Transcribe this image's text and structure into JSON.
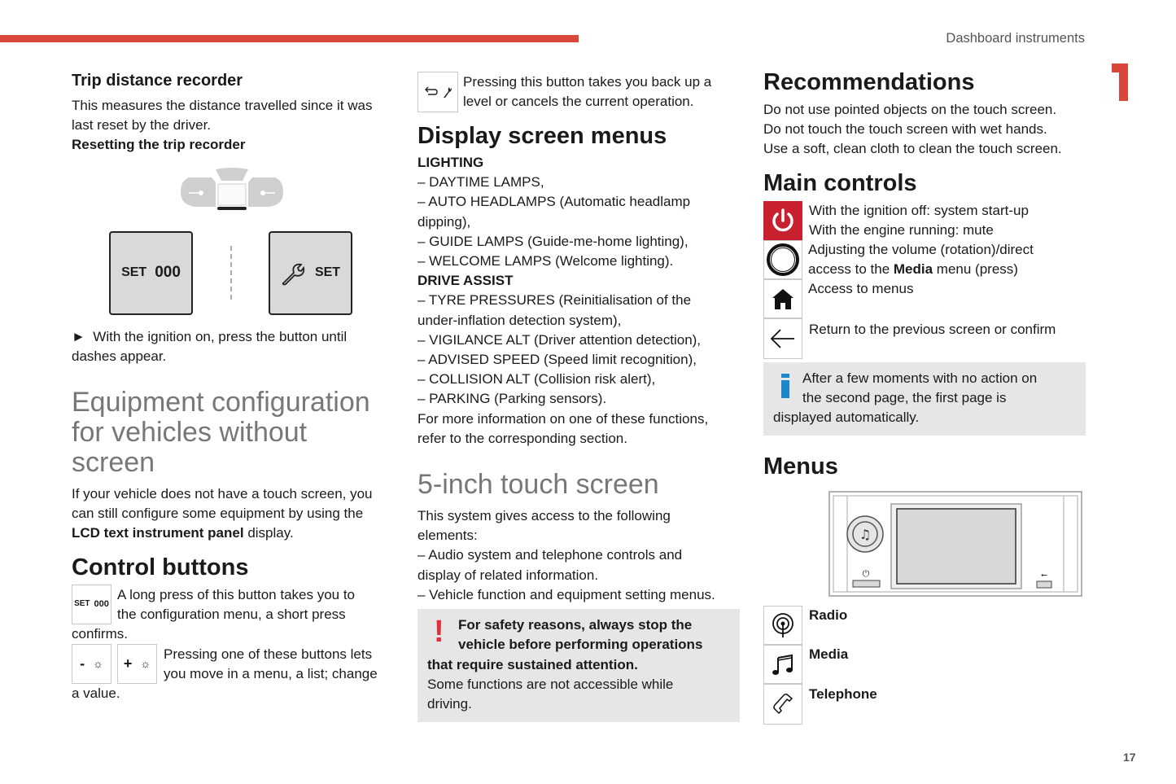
{
  "header": {
    "section_name": "Dashboard instruments",
    "chapter_number": "1",
    "page_number": "17",
    "accent_color": "#d9473a"
  },
  "col1": {
    "trip_title": "Trip distance recorder",
    "trip_desc_1": "This measures the distance travelled since it was",
    "trip_desc_2": "last reset by the driver.",
    "reset_title": "Resetting the trip recorder",
    "illustration": {
      "left_button": {
        "label": "SET",
        "value": "000"
      },
      "right_button": {
        "icon": "wrench-icon",
        "label": "SET"
      }
    },
    "instruction_marker": "►",
    "instruction_1": "With the ignition on, press the button until",
    "instruction_2": "dashes appear.",
    "equip_title_1": "Equipment configuration",
    "equip_title_2": "for vehicles without",
    "equip_title_3": "screen",
    "equip_desc_1": "If your vehicle does not have a touch screen, you",
    "equip_desc_2": "can still configure some equipment by using the",
    "equip_desc_3_bold": "LCD text instrument panel",
    "equip_desc_3_rest": " display.",
    "control_title": "Control buttons",
    "set_key": {
      "label": "SET",
      "value": "000"
    },
    "set_desc_1": "A long press of this button takes you to",
    "set_desc_2": "the configuration menu, a short press",
    "set_desc_3": "confirms.",
    "minus_key": {
      "sign": "-",
      "icon": "brightness-icon"
    },
    "plus_key": {
      "sign": "+",
      "icon": "brightness-icon"
    },
    "plusminus_desc_1": "Pressing one of these buttons lets",
    "plusminus_desc_2": "you move in a menu, a list; change",
    "plusminus_desc_3": "a value."
  },
  "col2": {
    "back_desc_1": "Pressing this button takes you back up a",
    "back_desc_2": "level or cancels the current operation.",
    "menus_title": "Display screen menus",
    "lighting_title": "LIGHTING",
    "lighting_items": [
      "–  DAYTIME LAMPS,",
      "–  AUTO HEADLAMPS (Automatic headlamp",
      "dipping),",
      "–  GUIDE LAMPS (Guide-me-home lighting),",
      "–  WELCOME LAMPS (Welcome lighting)."
    ],
    "drive_title": "DRIVE ASSIST",
    "drive_items": [
      "–  TYRE PRESSURES (Reinitialisation of the",
      "under-inflation detection system),",
      "–  VIGILANCE ALT (Driver attention detection),",
      "–  ADVISED SPEED (Speed limit recognition),",
      "–  COLLISION ALT (Collision risk alert),",
      "–  PARKING (Parking sensors)."
    ],
    "more_info_1": "For more information on one of these functions,",
    "more_info_2": "refer to the corresponding section.",
    "touch_title": "5-inch touch screen",
    "touch_lines": [
      "This system gives access to the following",
      "elements:",
      "–  Audio system and telephone controls and",
      "display of related information.",
      "–  Vehicle function and equipment setting menus."
    ],
    "warning": {
      "icon": "!",
      "bold_1": "For safety reasons, always stop the",
      "bold_2": "vehicle before performing operations",
      "bold_3": "that require sustained attention.",
      "text_1": "Some functions are not accessible while",
      "text_2": "driving.",
      "icon_color": "#e0303e"
    }
  },
  "col3": {
    "rec_title": "Recommendations",
    "rec_lines": [
      "Do not use pointed objects on the touch screen.",
      "Do not touch the touch screen with wet hands.",
      "Use a soft, clean cloth to clean the touch screen."
    ],
    "main_title": "Main controls",
    "controls": [
      {
        "icon": "power-icon",
        "lines": [
          "With the ignition off: system start-up",
          "With the engine running: mute"
        ]
      },
      {
        "icon": "volume-knob-icon",
        "line1": "Adjusting the volume (rotation)/direct",
        "line2_pre": "access to the ",
        "line2_bold": "Media",
        "line2_post": " menu (press)"
      },
      {
        "icon": "home-icon",
        "line": "Access to menus"
      },
      {
        "icon": "back-arrow-icon",
        "line": "Return to the previous screen or confirm"
      }
    ],
    "power_color": "#c8202f",
    "info": {
      "icon": "i",
      "line1": "After a few moments with no action on",
      "line2": "the second page, the first page is",
      "line3": "displayed automatically.",
      "icon_color": "#1b87c9"
    },
    "menus_title": "Menus",
    "menus": [
      {
        "icon": "radio-icon",
        "label": "Radio"
      },
      {
        "icon": "music-note-icon",
        "label": "Media"
      },
      {
        "icon": "telephone-icon",
        "label": "Telephone"
      }
    ]
  }
}
